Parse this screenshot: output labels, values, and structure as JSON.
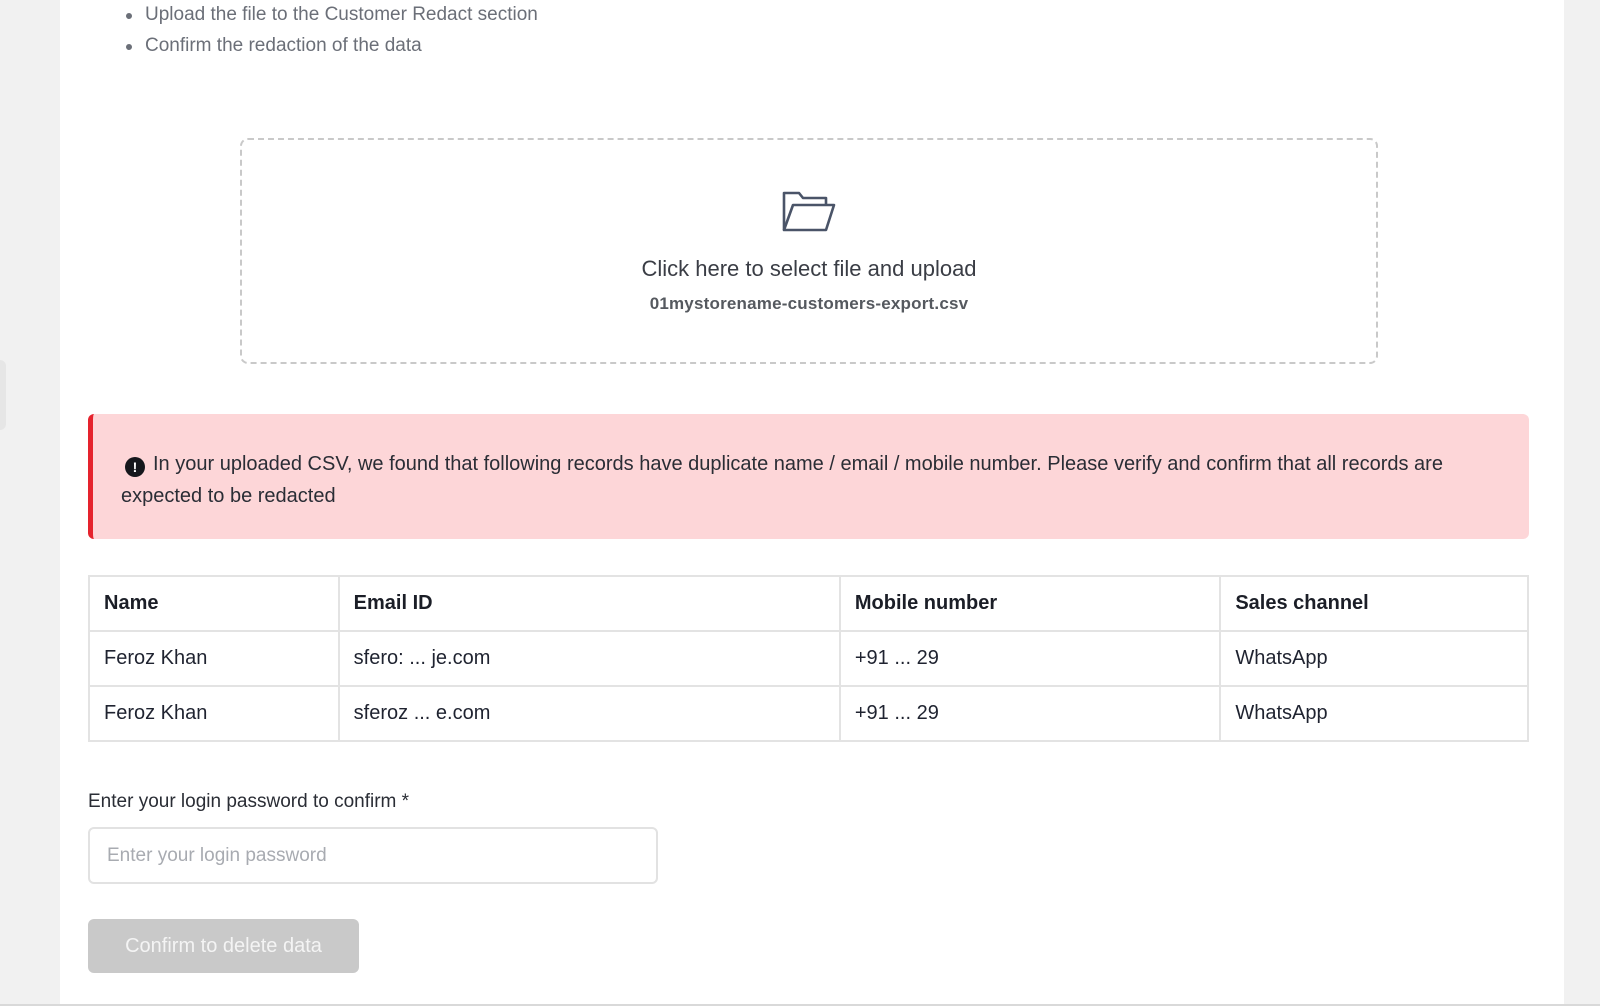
{
  "instructions": {
    "steps": [
      "Upload the file to the Customer Redact section",
      "Confirm the redaction of the data"
    ]
  },
  "upload": {
    "title": "Click here to select file and upload",
    "file_name": "01mystorename-customers-export.csv",
    "icon": "folder-open-icon"
  },
  "alert": {
    "icon": "exclamation-circle-icon",
    "message": "In your uploaded CSV, we found that following records have duplicate name / email / mobile number. Please verify and confirm that all records are expected to be redacted",
    "colors": {
      "background": "#fdd6d8",
      "accent": "#e5232d"
    }
  },
  "duplicates_table": {
    "columns": [
      "Name",
      "Email ID",
      "Mobile number",
      "Sales channel"
    ],
    "rows": [
      [
        "Feroz Khan",
        "sfero: ... je.com",
        "+91 ... 29",
        "WhatsApp"
      ],
      [
        "Feroz Khan",
        "sferoz ... e.com",
        "+91 ... 29",
        "WhatsApp"
      ]
    ]
  },
  "password": {
    "label": "Enter your login password to confirm *",
    "placeholder": "Enter your login password",
    "value": ""
  },
  "confirm_button": {
    "label": "Confirm to delete data",
    "state": "disabled"
  }
}
